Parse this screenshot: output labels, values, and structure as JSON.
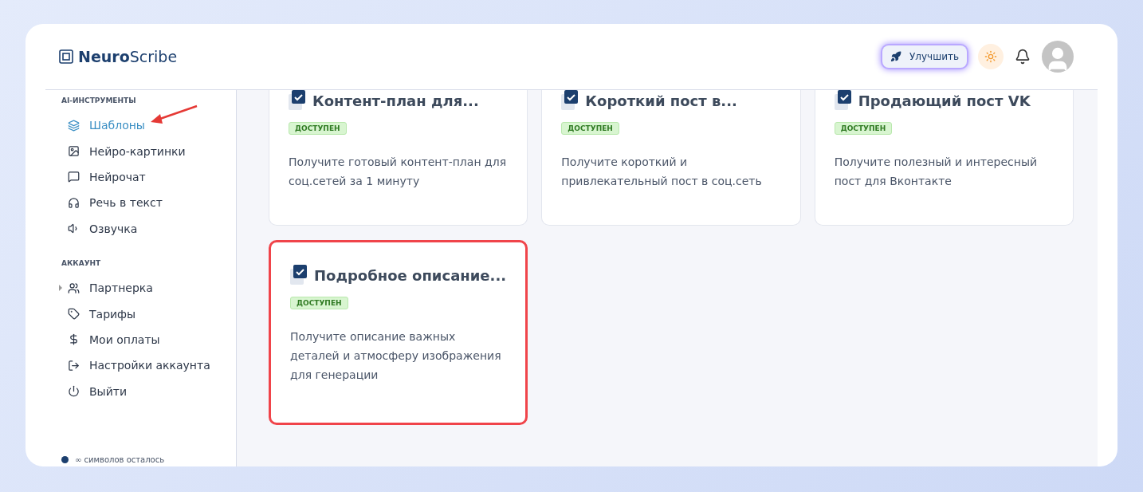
{
  "brand": {
    "bold": "Neuro",
    "light": "Scribe"
  },
  "header": {
    "upgrade_button": "Улучшить"
  },
  "sidebar": {
    "sections": [
      {
        "title": "AI-ИНСТРУМЕНТЫ",
        "items": [
          {
            "label": "Шаблоны",
            "selected": true
          },
          {
            "label": "Нейро-картинки",
            "selected": false
          },
          {
            "label": "Нейрочат",
            "selected": false
          },
          {
            "label": "Речь в текст",
            "selected": false
          },
          {
            "label": "Озвучка",
            "selected": false
          }
        ]
      },
      {
        "title": "АККАУНТ",
        "items": [
          {
            "label": "Партнерка",
            "selected": false,
            "expandable": true
          },
          {
            "label": "Тарифы",
            "selected": false,
            "expandable": false
          },
          {
            "label": "Мои оплаты",
            "selected": false,
            "expandable": false
          },
          {
            "label": "Настройки аккаунта",
            "selected": false,
            "expandable": false
          },
          {
            "label": "Выйти",
            "selected": false,
            "expandable": false
          }
        ]
      }
    ],
    "footer": "∞ символов осталось"
  },
  "cards": [
    {
      "title": "Контент-план для...",
      "badge": "ДОСТУПЕН",
      "description": "Получите готовый контент-план для соц.сетей за 1 минуту",
      "highlighted": false
    },
    {
      "title": "Короткий пост в...",
      "badge": "ДОСТУПЕН",
      "description": "Получите короткий и привлекательный пост в соц.сеть",
      "highlighted": false
    },
    {
      "title": "Продающий пост VK",
      "badge": "ДОСТУПЕН",
      "description": "Получите полезный и интересный пост для Вконтакте",
      "highlighted": false
    },
    {
      "title": "Подробное описание...",
      "badge": "ДОСТУПЕН",
      "description": "Получите описание важных деталей и атмосферу изображения для генерации",
      "highlighted": true
    }
  ]
}
